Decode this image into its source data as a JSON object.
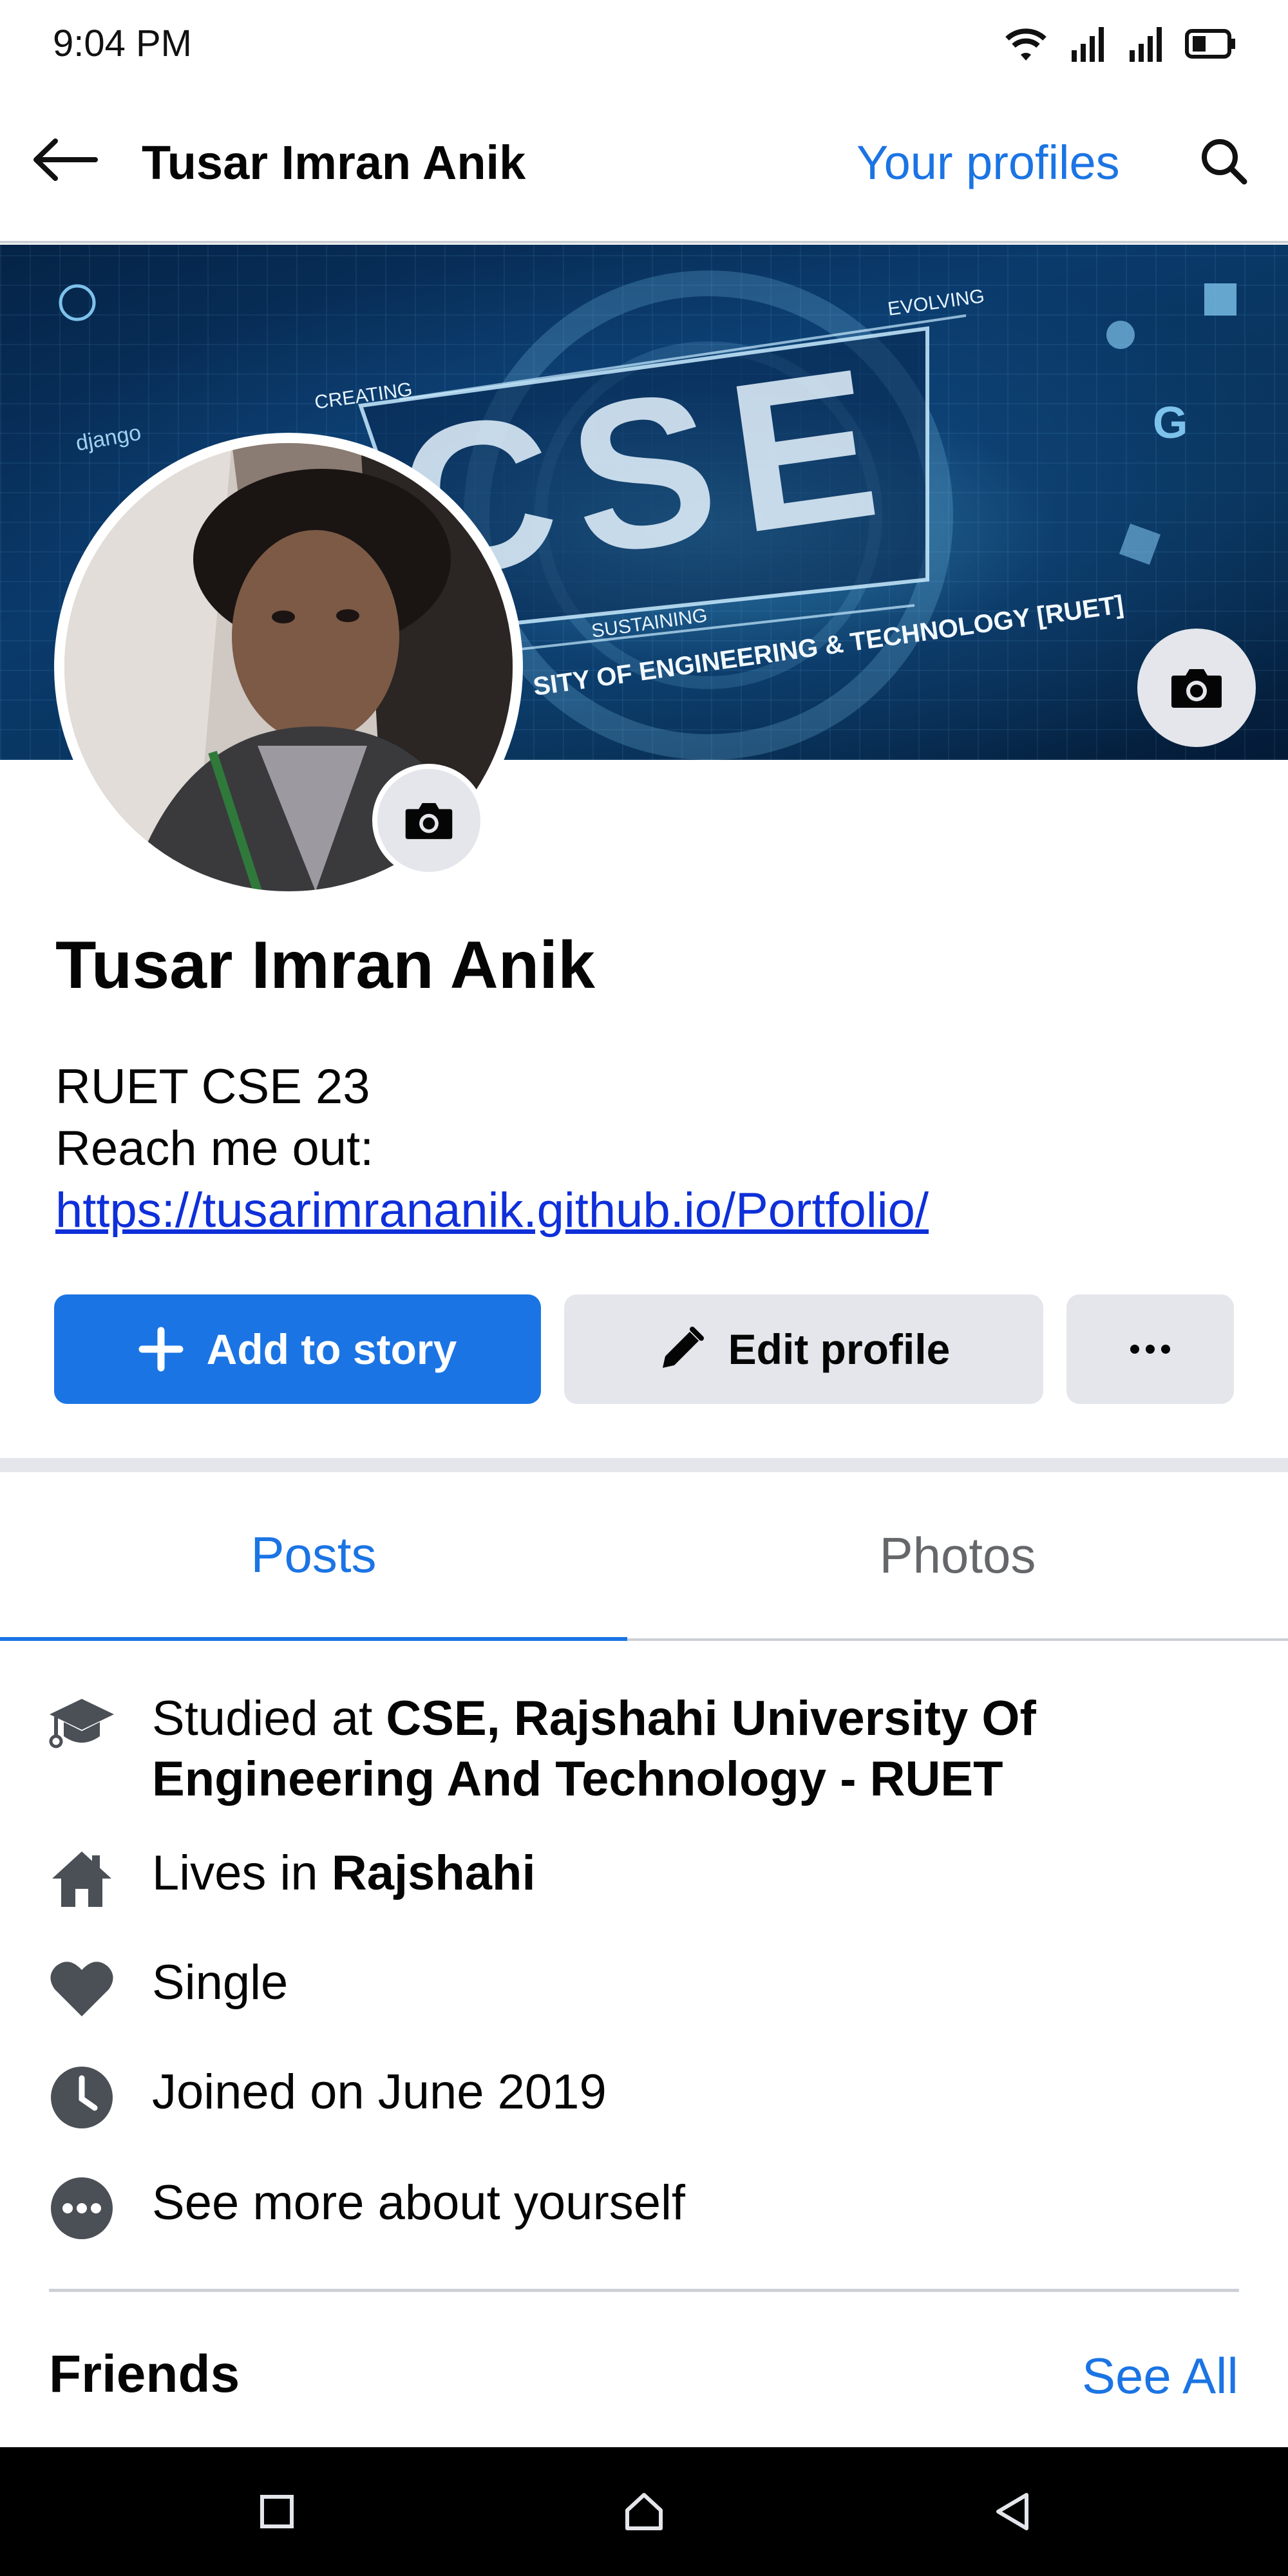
{
  "status_bar": {
    "time": "9:04 PM"
  },
  "app_bar": {
    "title": "Tusar Imran Anik",
    "your_profiles": "Your profiles"
  },
  "cover": {
    "banner_text_top": "EVOLVING",
    "banner_text_left": "CREATING",
    "banner_text_bottom": "SUSTAINING",
    "banner_caption": "SITY OF ENGINEERING & TECHNOLOGY [RUET]",
    "banner_big": "CSE",
    "django_tag": "django"
  },
  "profile": {
    "name": "Tusar Imran Anik",
    "bio_line1": "RUET CSE 23",
    "bio_line2": "Reach me out:",
    "bio_link": "https://tusarimrananik.github.io/Portfolio/"
  },
  "actions": {
    "add_story": "Add to story",
    "edit_profile": "Edit profile"
  },
  "tabs": {
    "posts": "Posts",
    "photos": "Photos"
  },
  "details": {
    "studied_prefix": "Studied at ",
    "studied_bold": "CSE, Rajshahi University Of Engineering And Technology - RUET",
    "lives_prefix": "Lives in ",
    "lives_bold": "Rajshahi",
    "relationship": "Single",
    "joined": "Joined on June 2019",
    "see_more": "See more about yourself"
  },
  "friends": {
    "title": "Friends",
    "see_all": "See All"
  },
  "colors": {
    "accent": "#1b74e4",
    "link": "#0e2fd9",
    "button_grey": "#e4e6eb",
    "icon_grey": "#4b4f56"
  }
}
